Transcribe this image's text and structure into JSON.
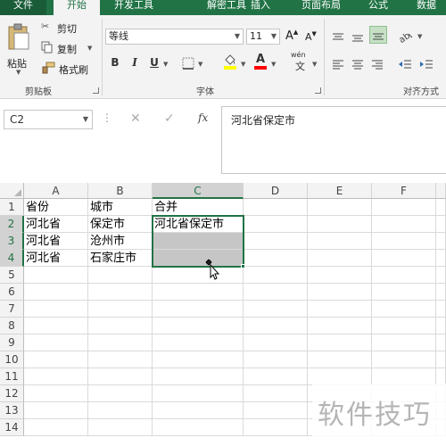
{
  "tabs": [
    "文件",
    "开始",
    "开发工具",
    "解密工具",
    "插入",
    "页面布局",
    "公式",
    "数据"
  ],
  "clipboard": {
    "paste_label": "粘贴",
    "cut_label": "剪切",
    "copy_label": "复制",
    "format_painter_label": "格式刷",
    "group_label": "剪贴板"
  },
  "font": {
    "name": "等线",
    "size": "11",
    "bold_label": "B",
    "italic_label": "I",
    "underline_label": "U",
    "phonetic_label": "wén",
    "phonetic_char": "文",
    "color_glyph": "A",
    "group_label": "字体",
    "grow_label": "A",
    "shrink_label": "A"
  },
  "alignment": {
    "group_label": "对齐方式"
  },
  "formula_bar": {
    "name_box": "C2",
    "content": "河北省保定市",
    "fx_label": "fx"
  },
  "columns": [
    "A",
    "B",
    "C",
    "D",
    "E",
    "F"
  ],
  "rows": [
    "1",
    "2",
    "3",
    "4",
    "5",
    "6",
    "7",
    "8",
    "9",
    "10",
    "11",
    "12",
    "13",
    "14"
  ],
  "cells": {
    "A1": "省份",
    "B1": "城市",
    "C1": "合并",
    "A2": "河北省",
    "B2": "保定市",
    "C2": "河北省保定市",
    "A3": "河北省",
    "B3": "沧州市",
    "A4": "河北省",
    "B4": "石家庄市"
  },
  "watermark": "软件技巧",
  "colors": {
    "accent": "#217346",
    "highlight_fill": "#ffff00",
    "font_color_red": "#ff0000",
    "selection_shade": "#c6c6c6"
  }
}
